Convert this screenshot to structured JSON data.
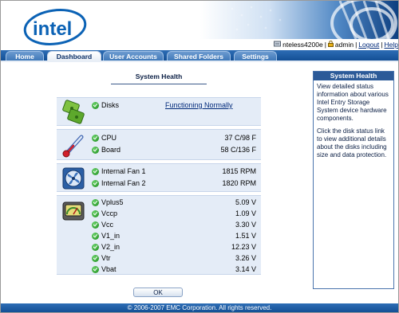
{
  "brand": {
    "logo_text": "intel"
  },
  "userbar": {
    "device": "nteless4200e",
    "user": "admin",
    "logout": "Logout",
    "help": "Help"
  },
  "tabs": [
    "Home",
    "Dashboard",
    "User Accounts",
    "Shared Folders",
    "Settings"
  ],
  "active_tab": "Dashboard",
  "section_title": "System Health",
  "groups": {
    "disks": {
      "icon": "disk-icon",
      "rows": [
        {
          "label": "Disks",
          "value": "Functioning Normally"
        }
      ]
    },
    "temperature": {
      "icon": "thermometer-icon",
      "rows": [
        {
          "label": "CPU",
          "value": "37 C/98 F"
        },
        {
          "label": "Board",
          "value": "58 C/136 F"
        }
      ]
    },
    "fans": {
      "icon": "fan-icon",
      "rows": [
        {
          "label": "Internal Fan 1",
          "value": "1815 RPM"
        },
        {
          "label": "Internal Fan 2",
          "value": "1820 RPM"
        }
      ]
    },
    "voltage": {
      "icon": "voltmeter-icon",
      "rows": [
        {
          "label": "Vplus5",
          "value": "5.09 V"
        },
        {
          "label": "Vccp",
          "value": "1.09 V"
        },
        {
          "label": "Vcc",
          "value": "3.30 V"
        },
        {
          "label": "V1_in",
          "value": "1.51 V"
        },
        {
          "label": "V2_in",
          "value": "12.23 V"
        },
        {
          "label": "Vtr",
          "value": "3.26 V"
        },
        {
          "label": "Vbat",
          "value": "3.14 V"
        }
      ]
    }
  },
  "ok_button": "OK",
  "help_box": {
    "title": "System Health",
    "para1": "View detailed status information about various Intel Entry Storage System device hardware components.",
    "para2": "Click the disk status link to view additional details about the disks including size and data protection."
  },
  "footer": "© 2006-2007 EMC Corporation. All rights reserved.",
  "colors": {
    "nav_blue": "#1d5aa3",
    "panel_bg": "#e4ecf7",
    "status_ok": "#1a8a1a"
  }
}
